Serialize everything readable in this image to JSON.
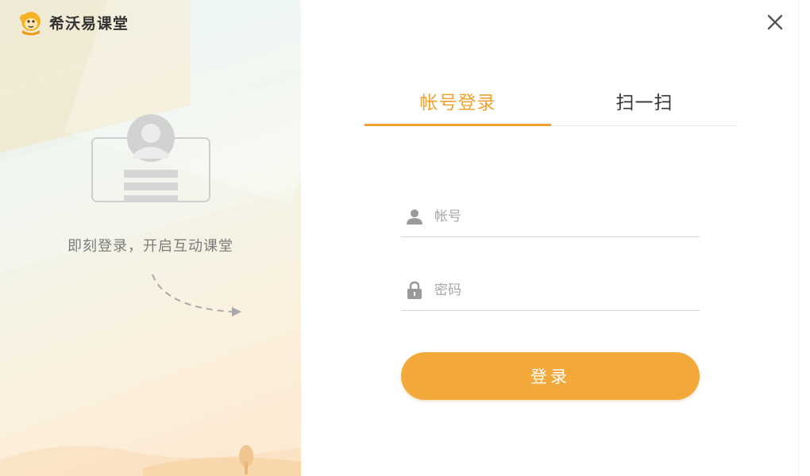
{
  "app": {
    "title": "希沃易课堂",
    "logo_icon": "monkey-logo-icon"
  },
  "left_panel": {
    "tagline": "即刻登录，开启互动课堂",
    "illustration_icon": "id-card-icon",
    "arrow_icon": "dashed-arrow-icon"
  },
  "window": {
    "close_icon": "close-icon"
  },
  "tabs": [
    {
      "label": "帐号登录",
      "active": true
    },
    {
      "label": "扫一扫",
      "active": false
    }
  ],
  "form": {
    "account_placeholder": "帐号",
    "account_value": "",
    "account_icon": "user-icon",
    "password_placeholder": "密码",
    "password_value": "",
    "password_icon": "lock-icon",
    "login_label": "登录"
  },
  "colors": {
    "accent": "#f0a130",
    "button": "#f3a83a",
    "text_dark": "#333333",
    "text_muted": "#7b7b7b"
  }
}
